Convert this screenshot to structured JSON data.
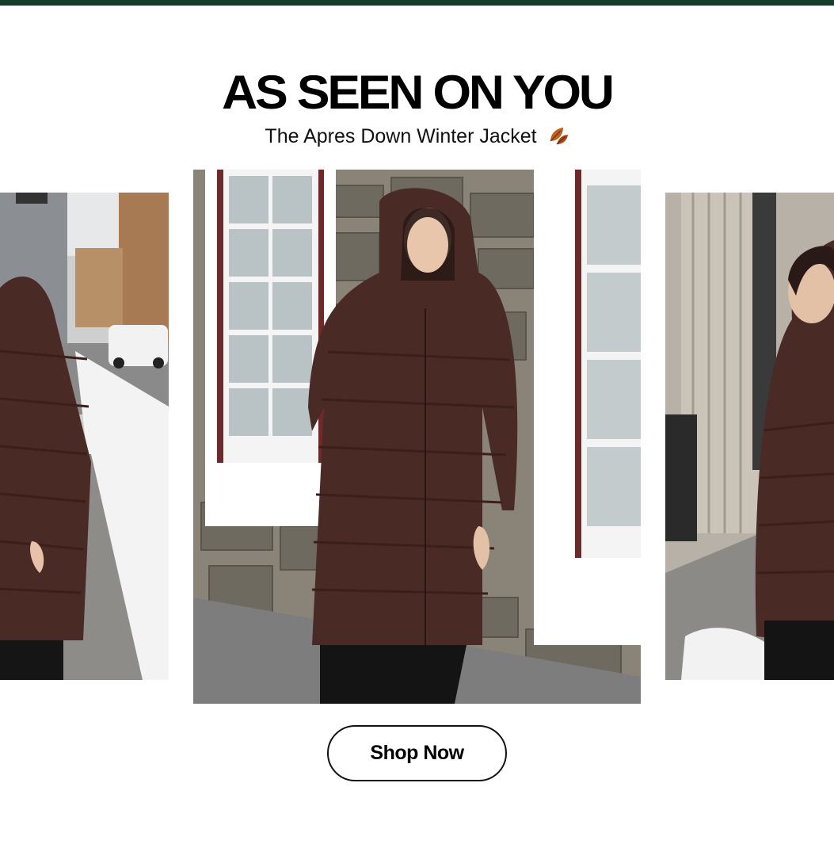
{
  "header": {
    "title": "AS SEEN ON YOU",
    "subtitle": "The Apres Down Winter Jacket",
    "subtitle_icon": "leaf-icon"
  },
  "gallery": {
    "images": [
      {
        "name": "photo-left",
        "description_icon": "photo"
      },
      {
        "name": "photo-center",
        "description_icon": "photo"
      },
      {
        "name": "photo-right",
        "description_icon": "photo"
      }
    ]
  },
  "cta": {
    "label": "Shop Now"
  },
  "colors": {
    "topbar": "#153b2a",
    "jacket": "#4a2a25",
    "text": "#000000"
  }
}
